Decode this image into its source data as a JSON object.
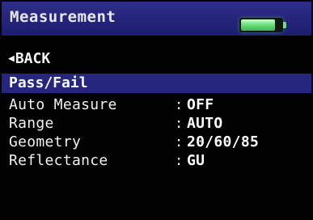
{
  "header": {
    "title": "Measurement",
    "battery_level": 0.85,
    "battery_color": "#6fe07f"
  },
  "nav": {
    "back_arrow": "◀",
    "back_label": "BACK"
  },
  "menu": {
    "selected_label": "Pass/Fail",
    "highlight_color": "#26267e",
    "items": [
      {
        "label": "Auto Measure",
        "separator": ":",
        "value": "OFF"
      },
      {
        "label": "Range",
        "separator": ":",
        "value": "AUTO"
      },
      {
        "label": "Geometry",
        "separator": ":",
        "value": "20/60/85"
      },
      {
        "label": "Reflectance",
        "separator": ":",
        "value": "GU"
      }
    ]
  }
}
